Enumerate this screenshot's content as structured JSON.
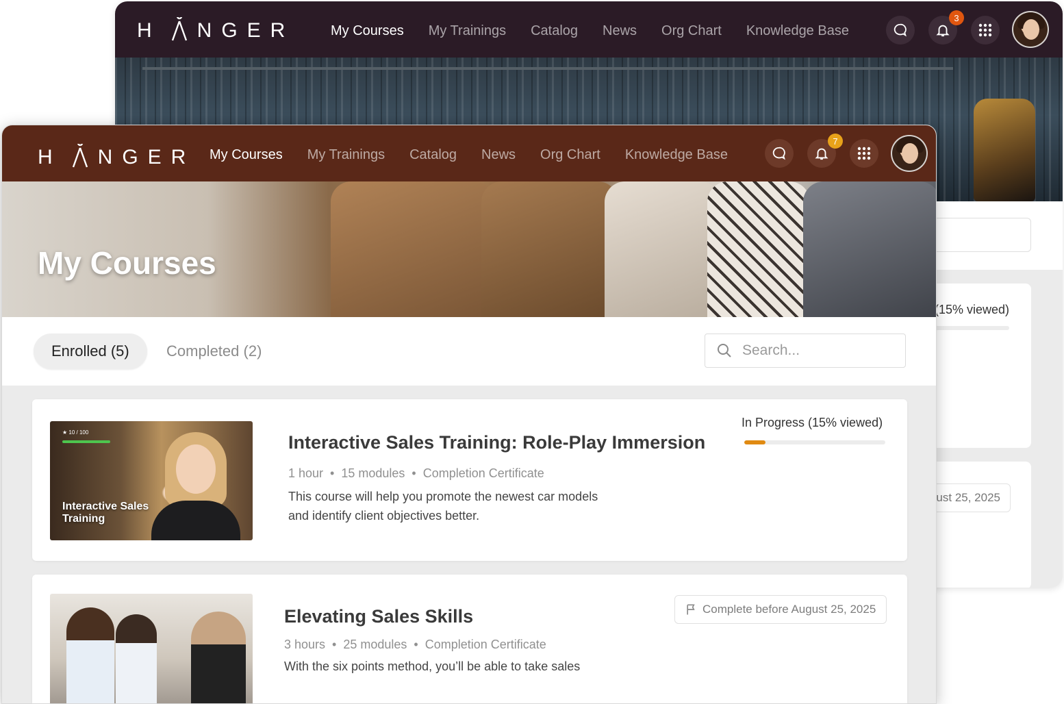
{
  "brand": {
    "logo_text": "NGER",
    "logo_prefix": "H"
  },
  "nav": {
    "links": [
      "My Courses",
      "My Trainings",
      "Catalog",
      "News",
      "Org Chart",
      "Knowledge Base"
    ],
    "active": "My Courses"
  },
  "back_window": {
    "notification_count": "3",
    "progress_text": "(15% viewed)",
    "due_text": "ust 25, 2025"
  },
  "front_window": {
    "notification_count": "7",
    "page_title": "My Courses",
    "tabs": [
      {
        "label": "Enrolled (5)",
        "active": true
      },
      {
        "label": "Completed (2)",
        "active": false
      }
    ],
    "search": {
      "placeholder": "Search..."
    },
    "courses": [
      {
        "title": "Interactive Sales Training: Role-Play Immersion",
        "duration": "1 hour",
        "modules": "15 modules",
        "certificate": "Completion Certificate",
        "description": "This course will help you promote the newest car models and identify client objectives better.",
        "status": "In Progress (15% viewed)",
        "progress_percent": 15,
        "thumb_caption": "Interactive Sales Training",
        "thumb_score": "★ 10 / 100"
      },
      {
        "title": "Elevating Sales Skills",
        "duration": "3 hours",
        "modules": "25 modules",
        "certificate": "Completion Certificate",
        "description": "With the six points method, you’ll be able to take sales",
        "due": "Complete before August 25, 2025"
      }
    ]
  },
  "colors": {
    "back_nav": "#2b1b26",
    "front_nav": "#5a2818",
    "accent": "#e58b1a",
    "badge": "#e0560f",
    "badge_front": "#e8a21a"
  },
  "icons": [
    "chat-icon",
    "bell-icon",
    "apps-grid-icon",
    "search-icon",
    "flag-icon"
  ]
}
